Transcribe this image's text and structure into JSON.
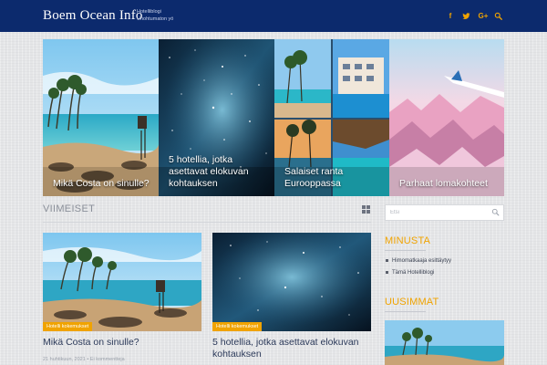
{
  "site": {
    "title": "Boem Ocean Info",
    "tagline_line1": "Hotelliblogi",
    "tagline_line2": "Unohtumaton yö"
  },
  "header": {
    "social": [
      {
        "name": "facebook-icon",
        "glyph": "f"
      },
      {
        "name": "twitter-icon",
        "glyph": "t"
      },
      {
        "name": "google-plus-icon",
        "glyph": "G+"
      },
      {
        "name": "search-icon",
        "glyph": ""
      }
    ]
  },
  "slider": {
    "slides": [
      {
        "caption": "Mikä Costa on sinulle?"
      },
      {
        "caption": "5 hotellia, jotka asettavat elokuvan kohtauksen"
      },
      {
        "caption": "Salaiset ranta Eurooppassa"
      },
      {
        "caption": "Parhaat lomakohteet"
      }
    ]
  },
  "latest": {
    "heading": "VIIMEISET",
    "layout_icon": "grid-icon",
    "posts": [
      {
        "tag": "Hotelli kokemukset",
        "title": "Mikä Costa on sinulle?",
        "meta": "21 huhtikuun, 2021 • Ei kommentteja"
      },
      {
        "tag": "Hotelli kokemukset",
        "title": "5 hotellia, jotka asettavat elokuvan kohtauksen",
        "meta": ""
      }
    ]
  },
  "sidebar": {
    "search_placeholder": "Etsi",
    "about_title": "MINUSTA",
    "about_items": [
      "Himomatkaaja esittäytyy",
      "Tämä Hotelliblogi"
    ],
    "recent_title": "UUSIMMAT"
  },
  "colors": {
    "header_bg": "#0c2a6d",
    "accent": "#f0a300",
    "title_text": "#2c3a5a"
  }
}
